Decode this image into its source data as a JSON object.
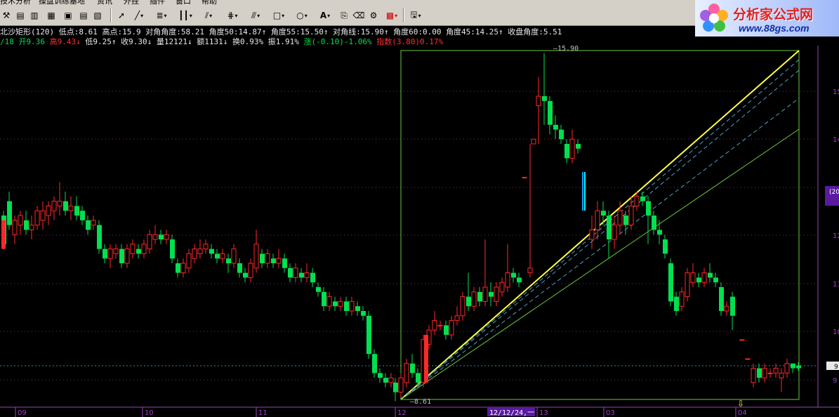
{
  "menu": [
    "技术分析",
    "操盘训练基地",
    "资讯",
    "外挂",
    "插件",
    "窗口",
    "帮助"
  ],
  "toolbar_icons": [
    "cursor-icon",
    "line-icon",
    "text-align-icon",
    "vertical-lines-icon",
    "fan-lines-icon",
    "channel-icon",
    "parallel-lines-icon",
    "rectangle-icon",
    "ellipse-icon",
    "text-tool-icon",
    "copy-icon",
    "eraser-icon",
    "settings-icon",
    "color-grid-icon",
    "save-icon"
  ],
  "logo": {
    "cn": "分析家公式网",
    "url": "www.88gs.com"
  },
  "indicator": {
    "name": "北沙矩形(120)",
    "low": "低点:8.61",
    "high": "高点:15.9",
    "diag_angle": "对角角度:58.21",
    "angle50": "角度50:14.87↑",
    "angle55": "角度55:15.50↑",
    "diag_line": "对角线:15.90↑",
    "angle60": "角度60:0.00",
    "angle45": "角度45:14.25↑",
    "close_angle": "收盘角度:5.51"
  },
  "quote": {
    "date": "/18",
    "open": "开9.36",
    "high": "高9.43↓",
    "low": "低9.25↑",
    "close": "收9.30↓",
    "vol": "量12121↓",
    "amount": "额1131↓",
    "turnover": "换0.93%",
    "amplitude": "振1.91%",
    "change": "涨(-0.10)-1.06%",
    "index": "指数(3.80)0.17%"
  },
  "chart_labels": {
    "high_mark": "—15.90",
    "low_mark": "—8.61",
    "axis_box": "(20",
    "price_tag": "9"
  },
  "y_ticks": [
    "15",
    "14",
    "13",
    "12",
    "11",
    "10",
    "9"
  ],
  "x_labels": [
    "09",
    "10",
    "11",
    "12",
    "12/12/24,一",
    "13",
    "03",
    "04"
  ],
  "date_marker": "12/12/24,一",
  "colors": {
    "up": "#ff2828",
    "down": "#00e050",
    "yellow": "#ffff40",
    "grid": "#7a2a7a",
    "axis": "#a040c0",
    "rect": "#6ec83c",
    "dash": "#50a0c0"
  },
  "chart_data": {
    "type": "candlestick",
    "title": "北沙矩形(120)",
    "low_point": 8.61,
    "high_point": 15.9,
    "ylim": [
      8.6,
      16.0
    ],
    "y_ticks": [
      15,
      14,
      13,
      12,
      11,
      10,
      9
    ],
    "x_labels": [
      "09",
      "10",
      "11",
      "12",
      "13",
      "03",
      "04"
    ]
  }
}
